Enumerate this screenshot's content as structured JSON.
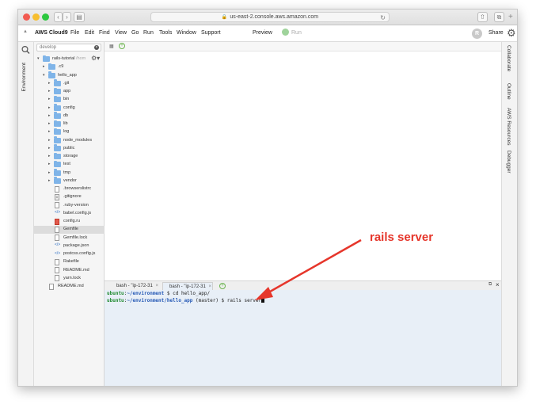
{
  "browser": {
    "url": "us-east-2.console.aws.amazon.com",
    "traffic_lights": [
      "#f25b51",
      "#f7be2f",
      "#2dc840"
    ]
  },
  "menubar": {
    "brand": "AWS Cloud9",
    "items": [
      "File",
      "Edit",
      "Find",
      "View",
      "Go",
      "Run",
      "Tools",
      "Window",
      "Support"
    ],
    "preview": "Preview",
    "run": "Run",
    "avatar": "R",
    "share": "Share"
  },
  "sidebar": {
    "tab": "Environment",
    "search_value": "develop",
    "root": {
      "name": "rails-tutorial",
      "path": "/hom"
    },
    "items": [
      {
        "name": ".c9",
        "type": "folder",
        "depth": 1
      },
      {
        "name": "hello_app",
        "type": "folder",
        "depth": 1,
        "open": true
      },
      {
        "name": ".git",
        "type": "folder",
        "depth": 2
      },
      {
        "name": "app",
        "type": "folder",
        "depth": 2
      },
      {
        "name": "bin",
        "type": "folder",
        "depth": 2
      },
      {
        "name": "config",
        "type": "folder",
        "depth": 2
      },
      {
        "name": "db",
        "type": "folder",
        "depth": 2
      },
      {
        "name": "lib",
        "type": "folder",
        "depth": 2
      },
      {
        "name": "log",
        "type": "folder",
        "depth": 2
      },
      {
        "name": "node_modules",
        "type": "folder",
        "depth": 2
      },
      {
        "name": "public",
        "type": "folder",
        "depth": 2
      },
      {
        "name": "storage",
        "type": "folder",
        "depth": 2
      },
      {
        "name": "test",
        "type": "folder",
        "depth": 2
      },
      {
        "name": "tmp",
        "type": "folder",
        "depth": 2
      },
      {
        "name": "vendor",
        "type": "folder",
        "depth": 2
      },
      {
        "name": ".browserslistrc",
        "type": "file",
        "depth": 2
      },
      {
        "name": ".gitignore",
        "type": "file",
        "depth": 2,
        "icon": "settings"
      },
      {
        "name": ".ruby-version",
        "type": "file",
        "depth": 2
      },
      {
        "name": "babel.config.js",
        "type": "file",
        "depth": 2,
        "icon": "code"
      },
      {
        "name": "config.ru",
        "type": "file",
        "depth": 2,
        "icon": "ruby"
      },
      {
        "name": "Gemfile",
        "type": "file",
        "depth": 2,
        "selected": true
      },
      {
        "name": "Gemfile.lock",
        "type": "file",
        "depth": 2
      },
      {
        "name": "package.json",
        "type": "file",
        "depth": 2,
        "icon": "code"
      },
      {
        "name": "postcss.config.js",
        "type": "file",
        "depth": 2,
        "icon": "code"
      },
      {
        "name": "Rakefile",
        "type": "file",
        "depth": 2
      },
      {
        "name": "README.md",
        "type": "file",
        "depth": 2
      },
      {
        "name": "yarn.lock",
        "type": "file",
        "depth": 2
      },
      {
        "name": "README.md",
        "type": "file",
        "depth": 1
      }
    ]
  },
  "right_tabs": [
    "Collaborate",
    "Outline",
    "AWS Resources",
    "Debugger"
  ],
  "terminal": {
    "tabs": [
      {
        "label": "bash - \"ip-172-31",
        "active": false
      },
      {
        "label": "bash - \"ip-172-31",
        "active": true
      }
    ],
    "lines": [
      {
        "user": "ubuntu",
        "path": "~/environment",
        "branch": "",
        "cmd": "cd hello_app/"
      },
      {
        "user": "ubuntu",
        "path": "~/environment/hello_app",
        "branch": "(master)",
        "cmd": "rails server"
      }
    ]
  },
  "annotation": {
    "text": "rails server",
    "color": "#e6362b"
  }
}
